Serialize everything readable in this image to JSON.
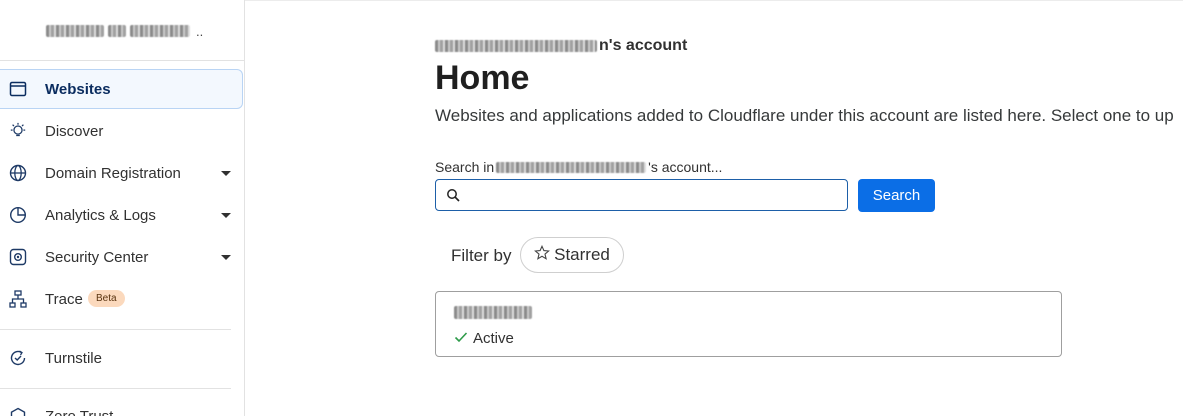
{
  "sidebar": {
    "items": [
      {
        "label": "Websites",
        "icon": "browser-window-icon",
        "active": true
      },
      {
        "label": "Discover",
        "icon": "lightbulb-icon"
      },
      {
        "label": "Domain Registration",
        "icon": "globe-icon",
        "expandable": true
      },
      {
        "label": "Analytics & Logs",
        "icon": "pie-chart-icon",
        "expandable": true
      },
      {
        "label": "Security Center",
        "icon": "shield-gear-icon",
        "expandable": true
      },
      {
        "label": "Trace",
        "icon": "sitemap-icon",
        "badge": "Beta"
      },
      {
        "label": "Turnstile",
        "icon": "refresh-check-icon"
      },
      {
        "label": "Zero Trust",
        "icon": "hexagon-icon"
      }
    ]
  },
  "main": {
    "breadcrumb_suffix": "n's account",
    "title": "Home",
    "description": "Websites and applications added to Cloudflare under this account are listed here. Select one to up",
    "search": {
      "label_prefix": "Search in",
      "label_suffix": "'s account...",
      "value": "",
      "button_label": "Search"
    },
    "filter": {
      "label": "Filter by",
      "starred_label": "Starred"
    },
    "site": {
      "status": "Active"
    }
  },
  "colors": {
    "accent": "#0b6ee6",
    "active_nav_bg": "#f3f8fe",
    "active_nav_border": "#b9d4f4",
    "beta_badge": "#fbd9bd",
    "status_ok": "#2e9b4a"
  }
}
